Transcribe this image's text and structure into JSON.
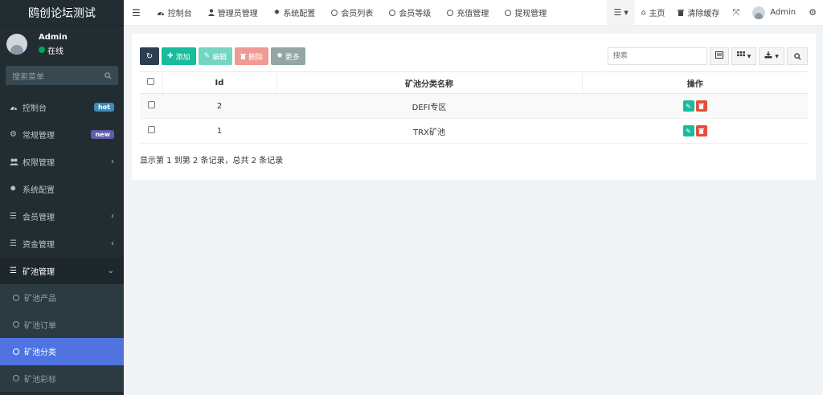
{
  "app": {
    "title": "鸥创论坛测试"
  },
  "user": {
    "name": "Admin",
    "status": "在线"
  },
  "sidebar": {
    "search_placeholder": "搜索菜单",
    "items": [
      {
        "label": "控制台",
        "icon": "dashboard-icon",
        "badge": "hot"
      },
      {
        "label": "常规管理",
        "icon": "cogs-icon",
        "badge": "new"
      },
      {
        "label": "权限管理",
        "icon": "users-icon",
        "chevron": "‹"
      },
      {
        "label": "系统配置",
        "icon": "gear-icon"
      },
      {
        "label": "会员管理",
        "icon": "list-icon",
        "chevron": "‹"
      },
      {
        "label": "资金管理",
        "icon": "list-icon",
        "chevron": "‹"
      },
      {
        "label": "矿池管理",
        "icon": "list-icon",
        "chevron": "⌄"
      }
    ],
    "submenu": [
      {
        "label": "矿池产品"
      },
      {
        "label": "矿池订单"
      },
      {
        "label": "矿池分类",
        "active": true
      },
      {
        "label": "矿池彩标"
      }
    ]
  },
  "topnav": {
    "items": [
      {
        "label": "控制台",
        "icon": "dashboard-icon"
      },
      {
        "label": "管理员管理",
        "icon": "user-icon"
      },
      {
        "label": "系统配置",
        "icon": "gear-icon"
      },
      {
        "label": "会员列表",
        "icon": "circle-icon"
      },
      {
        "label": "会员等级",
        "icon": "circle-icon"
      },
      {
        "label": "充值管理",
        "icon": "circle-icon"
      },
      {
        "label": "提现管理",
        "icon": "circle-icon"
      }
    ],
    "home": "主页",
    "clear_cache": "清除缓存",
    "admin": "Admin"
  },
  "toolbar": {
    "add": "添加",
    "edit": "编辑",
    "delete": "删除",
    "more": "更多",
    "search_placeholder": "搜索"
  },
  "table": {
    "columns": [
      "Id",
      "矿池分类名称",
      "操作"
    ],
    "rows": [
      {
        "id": "2",
        "name": "DEFI专区"
      },
      {
        "id": "1",
        "name": "TRX矿池"
      }
    ]
  },
  "pager": {
    "summary": "显示第 1 到第 2 条记录，总共 2 条记录"
  },
  "colors": {
    "sidebar_bg": "#222d32",
    "active_item": "#4f73e0",
    "add": "#18bc9c",
    "delete": "#e74c3c"
  }
}
